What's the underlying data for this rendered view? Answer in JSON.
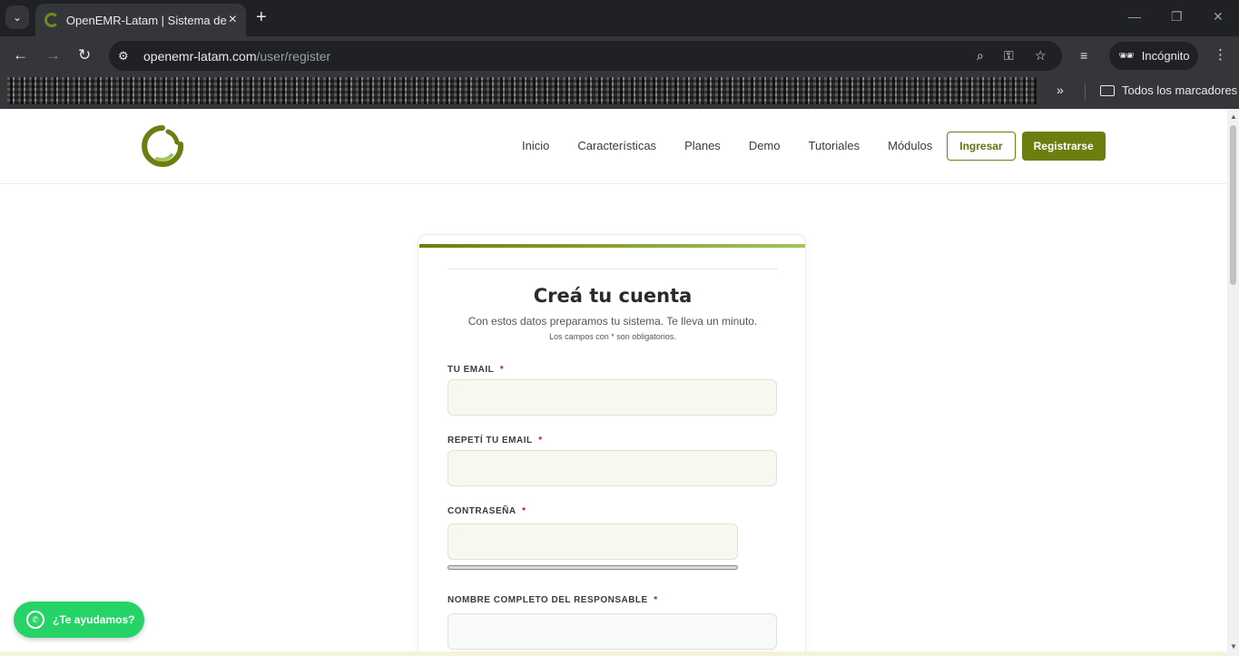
{
  "browser": {
    "tab_title": "OpenEMR-Latam | Sistema de H",
    "url_host": "openemr-latam.com",
    "url_path": "/user/register",
    "incognito_label": "Incógnito",
    "bookmarks_all": "Todos los marcadores"
  },
  "header": {
    "nav": [
      "Inicio",
      "Características",
      "Planes",
      "Demo",
      "Tutoriales",
      "Módulos"
    ],
    "login": "Ingresar",
    "register": "Registrarse"
  },
  "form": {
    "title": "Creá tu cuenta",
    "subtitle": "Con estos datos preparamos tu sistema. Te lleva un minuto.",
    "note_prefix": "Los campos con",
    "note_star": "*",
    "note_suffix": "son obligatorios.",
    "fields": [
      {
        "label": "TU EMAIL",
        "required": "*"
      },
      {
        "label": "REPETÍ TU EMAIL",
        "required": "*"
      },
      {
        "label": "CONTRASEÑA",
        "required": "*"
      },
      {
        "label": "NOMBRE COMPLETO DEL RESPONSABLE",
        "required": "*"
      }
    ]
  },
  "help": {
    "whatsapp_label": "¿Te ayudamos?"
  },
  "colors": {
    "brand": "#6b7f10",
    "accent_light": "#a3c45a",
    "whatsapp": "#25d366"
  }
}
